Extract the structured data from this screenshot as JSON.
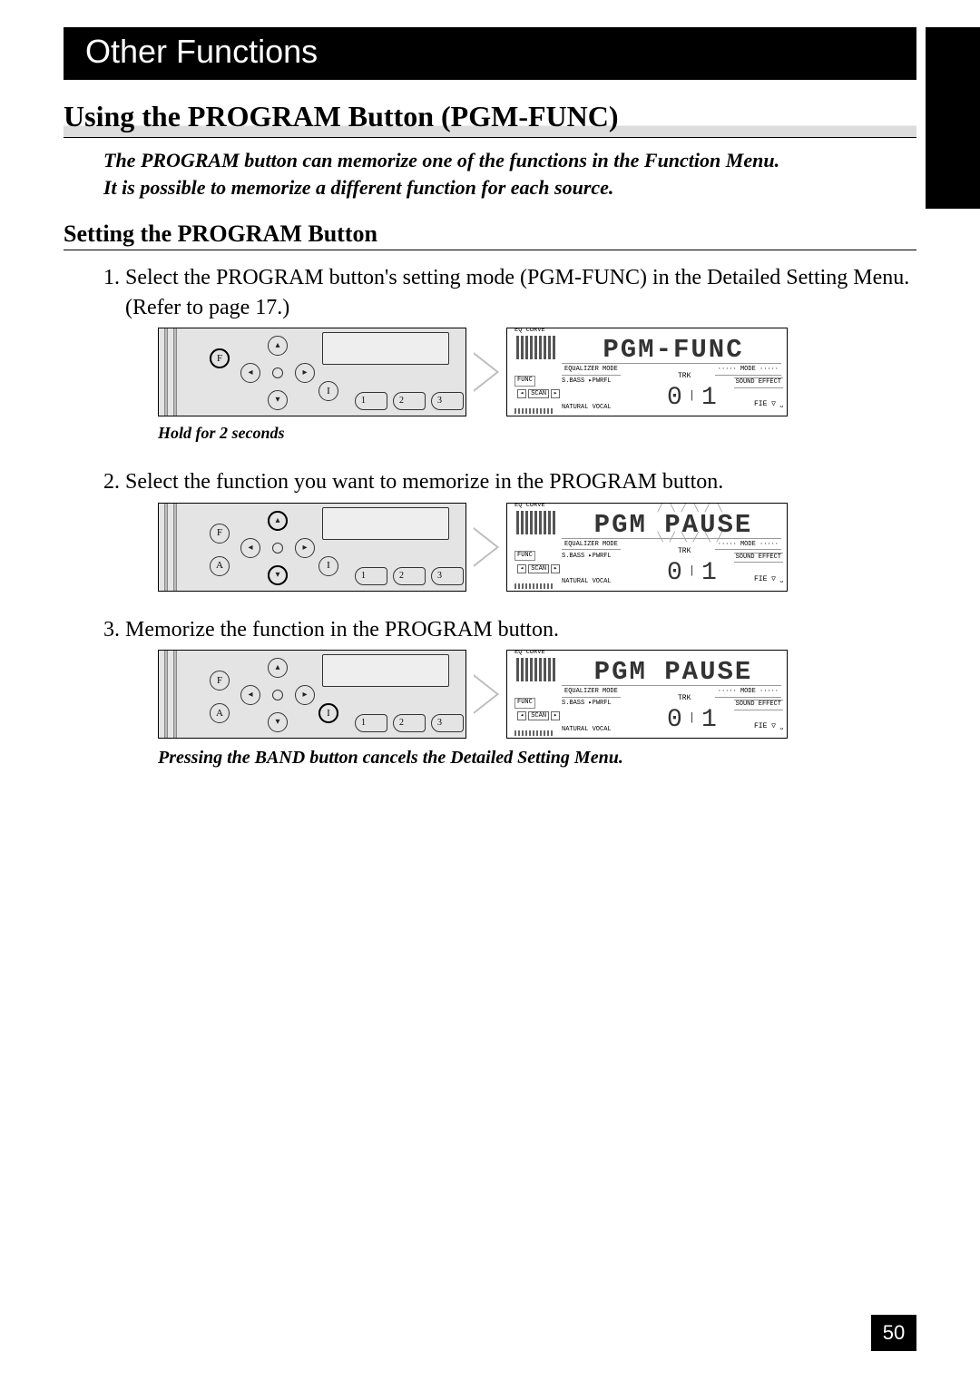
{
  "header": "Other Functions",
  "section_title": "Using the PROGRAM Button (PGM-FUNC)",
  "intro_line1": "The PROGRAM button can memorize one of the functions in the Function Menu.",
  "intro_line2": "It is possible to memorize a different function for each source.",
  "subsection": "Setting the PROGRAM Button",
  "steps": {
    "s1": "Select the PROGRAM button's setting mode (PGM-FUNC) in the Detailed Setting Menu. (Refer to page 17.)",
    "s2": "Select the function you want to memorize in the PROGRAM button.",
    "s3": "Memorize the function in the PROGRAM button."
  },
  "hold_note": "Hold for 2 seconds",
  "cancel_note": "Pressing the BAND button cancels the Detailed Setting Menu.",
  "panel": {
    "btn_f": "F",
    "btn_a": "A",
    "btn_i": "I",
    "n1": "1",
    "n2": "2",
    "n3": "3",
    "up": "▴",
    "down": "▾",
    "left": "◂",
    "right": "▸"
  },
  "lcd": {
    "eq_curve": "EQ CURVE",
    "eq_mode": "EQUALIZER MODE",
    "mode": "····· MODE ·····",
    "sbass": "S.BASS ▸PWRFL",
    "trk": "TRK",
    "sound_effect": "SOUND EFFECT",
    "natural": "NATURAL  VOCAL",
    "fie": "FIE ▽ ⎵",
    "func": "FUNC",
    "scan_l": "◂",
    "scan_m": "SCAN",
    "scan_r": "▸",
    "num_l": "0",
    "num_r": "1",
    "disp1": "PGM-FUNC",
    "disp2": "PGM PAUSE",
    "disp3": "PGM PAUSE"
  },
  "page_number": "50"
}
